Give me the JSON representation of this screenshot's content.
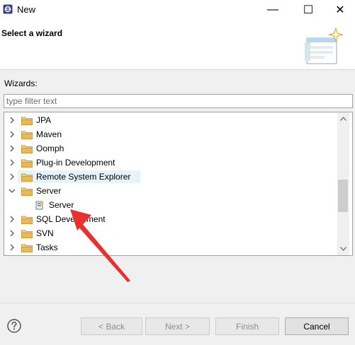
{
  "window": {
    "title": "New"
  },
  "title_buttons": {
    "minimize": "—",
    "maximize": "☐",
    "close": "✕"
  },
  "header": {
    "title": "Select a wizard"
  },
  "wizards_label": "Wizards:",
  "filter": {
    "placeholder": "type filter text",
    "value": ""
  },
  "tree_items": [
    {
      "label": "JPA",
      "expanded": false,
      "level": 0,
      "icon": "folder-icon"
    },
    {
      "label": "Maven",
      "expanded": false,
      "level": 0,
      "icon": "folder-icon"
    },
    {
      "label": "Oomph",
      "expanded": false,
      "level": 0,
      "icon": "folder-icon"
    },
    {
      "label": "Plug-in Development",
      "expanded": false,
      "level": 0,
      "icon": "folder-icon"
    },
    {
      "label": "Remote System Explorer",
      "expanded": false,
      "level": 0,
      "icon": "folder-icon",
      "hovered": true
    },
    {
      "label": "Server",
      "expanded": true,
      "level": 0,
      "icon": "folder-icon"
    },
    {
      "label": "Server",
      "level": 1,
      "icon": "server-wizard-icon"
    },
    {
      "label": "SQL Development",
      "expanded": false,
      "level": 0,
      "icon": "folder-icon"
    },
    {
      "label": "SVN",
      "expanded": false,
      "level": 0,
      "icon": "folder-icon"
    },
    {
      "label": "Tasks",
      "expanded": false,
      "level": 0,
      "icon": "folder-icon"
    }
  ],
  "buttons": {
    "back": "< Back",
    "next": "Next >",
    "finish": "Finish",
    "cancel": "Cancel"
  },
  "colors": {
    "hover_row": "#e5f3fb",
    "folder": "#e8b85a",
    "annotation_arrow": "#e8312f"
  }
}
